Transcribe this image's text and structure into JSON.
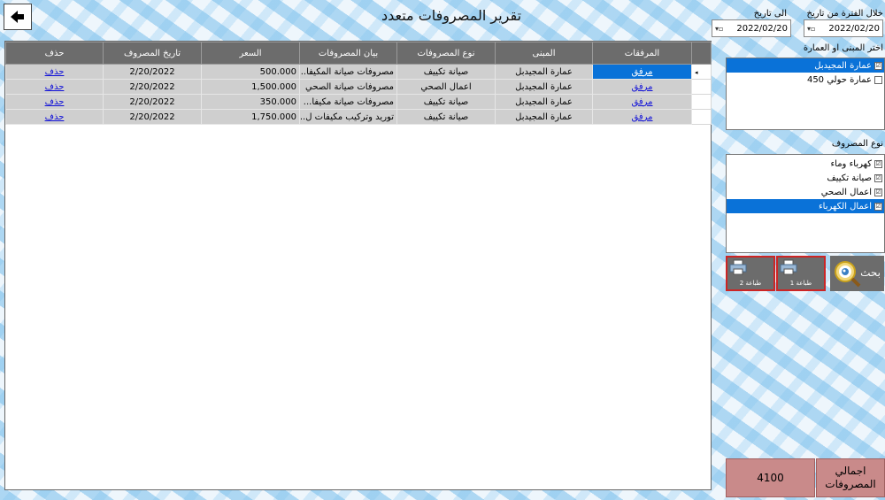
{
  "title": "تقرير المصروفات متعدد",
  "filters": {
    "from_label": "خلال الفترة من تاريخ",
    "to_label": "الى تاريخ",
    "from_date": "2022/02/20",
    "to_date": "2022/02/20",
    "buildings_label": "اختر المبنى او العمارة",
    "buildings": [
      {
        "label": "عمارة المجيدبل",
        "checked": true,
        "selected": true
      },
      {
        "label": "عمارة حولي 450",
        "checked": false,
        "selected": false
      }
    ],
    "expense_types_label": "نوع المصروف",
    "expense_types": [
      {
        "label": "كهرباء وماء",
        "checked": true,
        "selected": false
      },
      {
        "label": "صيانة تكييف",
        "checked": true,
        "selected": false
      },
      {
        "label": "اعمال الصحي",
        "checked": true,
        "selected": false
      },
      {
        "label": "اعمال الكهرباء",
        "checked": true,
        "selected": true
      }
    ]
  },
  "buttons": {
    "search": "بحث",
    "print1": "طباعة 1",
    "print2": "طباعة 2"
  },
  "table": {
    "headers": {
      "attachments": "المرفقات",
      "building": "المبنى",
      "expense_type": "نوع المصروفات",
      "description": "بيان المصروفات",
      "price": "السعر",
      "date": "تاريخ المصروف",
      "delete": "حذف"
    },
    "rows": [
      {
        "attachment": "مرفق",
        "building": "عمارة المجيدبل",
        "expense_type": "صيانة تكييف",
        "description": "مصروفات صيانة المكيفا...",
        "price": "500.000",
        "date": "2/20/2022",
        "delete": "حذف"
      },
      {
        "attachment": "مرفق",
        "building": "عمارة المجيدبل",
        "expense_type": "اعمال الصحي",
        "description": "مصروفات صيانة الصحي",
        "price": "1,500.000",
        "date": "2/20/2022",
        "delete": "حذف"
      },
      {
        "attachment": "مرفق",
        "building": "عمارة المجيدبل",
        "expense_type": "صيانة تكييف",
        "description": "مصروفات صيانة مكيفا...",
        "price": "350.000",
        "date": "2/20/2022",
        "delete": "حذف"
      },
      {
        "attachment": "مرفق",
        "building": "عمارة المجيدبل",
        "expense_type": "صيانة تكييف",
        "description": "توريد وتركيب مكيفات ل...",
        "price": "1,750.000",
        "date": "2/20/2022",
        "delete": "حذف"
      }
    ]
  },
  "totals": {
    "label": "اجمالي المصروفات",
    "value": "4100"
  },
  "icons": {
    "back": "back-arrow-icon",
    "search": "magnifier-eye-icon",
    "print": "printer-icon"
  },
  "colors": {
    "selection": "#0a72d8",
    "header_bg": "#6c6c6c",
    "row_bg": "#cfcfcf",
    "totals_bg": "#c98a8a",
    "button_outline": "#cc2525"
  }
}
